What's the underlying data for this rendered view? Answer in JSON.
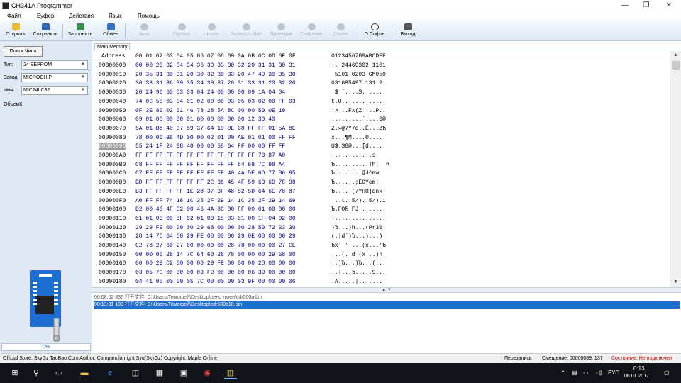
{
  "window": {
    "title": "CH341A Programmer",
    "minimize": "—",
    "restore": "❐",
    "close": "✕"
  },
  "menu": [
    "Файл",
    "Буфер",
    "Действия",
    "Язык",
    "Помощь"
  ],
  "toolbar": [
    {
      "label": "Открыть",
      "icon": "folder-open-icon",
      "enabled": true
    },
    {
      "label": "Сохранить",
      "icon": "save-icon",
      "enabled": true
    },
    {
      "label": "Заполнить",
      "icon": "fill-icon",
      "enabled": true
    },
    {
      "label": "Обмен",
      "icon": "swap-icon",
      "enabled": true
    },
    {
      "label": "Авто",
      "icon": "auto-icon",
      "enabled": false
    },
    {
      "label": "Пустые",
      "icon": "blank-check-icon",
      "enabled": false
    },
    {
      "label": "Читать",
      "icon": "read-icon",
      "enabled": false
    },
    {
      "label": "Записать Чип",
      "icon": "write-chip-icon",
      "enabled": false
    },
    {
      "label": "Проверка",
      "icon": "verify-icon",
      "enabled": false
    },
    {
      "label": "Стирание",
      "icon": "erase-icon",
      "enabled": false
    },
    {
      "label": "Отмен",
      "icon": "cancel-icon",
      "enabled": false
    },
    {
      "label": "О Софте",
      "icon": "info-icon",
      "enabled": true
    },
    {
      "label": "Выход",
      "icon": "exit-icon",
      "enabled": true
    }
  ],
  "left": {
    "find_chip": "Поиск Чипа",
    "type_label": "Тип:",
    "type_value": "24 EEPROM",
    "vendor_label": "Завод",
    "vendor_value": "MICROCHIP",
    "name_label": "Имя:",
    "name_value": "MIC24LC32",
    "size_label": "ОбъемК",
    "progress": "0%"
  },
  "tab": "Main Memory",
  "hex": {
    "header_addr": "Address",
    "header_cols": "00 01 02 03 04 05 06 07 08 09 0A 0B 0C 0D 0E 0F",
    "header_text": "0123456789ABCDEF",
    "current_row": 9,
    "rows": [
      {
        "addr": "00000000",
        "bytes": "00 00 20 32 34 34 36 39 33 30 32 20 31 31 30 31",
        "text": ".. 24469302 1101"
      },
      {
        "addr": "00000010",
        "bytes": "20 35 31 30 31 20 30 32 30 33 20 47 4D 30 35 30",
        "text": " 5101 0203 GM050"
      },
      {
        "addr": "00000020",
        "bytes": "30 33 31 36 39 35 34 39 37 20 31 33 31 20 32 20",
        "text": "031695497 131 2 "
      },
      {
        "addr": "00000030",
        "bytes": "20 24 96 60 03 03 04 24 00 00 00 09 1A 04 04",
        "text": " $ `....$......."
      },
      {
        "addr": "00000040",
        "bytes": "74 0C 55 03 04 01 02 00 00 03 05 03 02 00 FF 03",
        "text": "t.U............."
      },
      {
        "addr": "00000050",
        "bytes": "0F 3E 80 02 01 46 78 28 5A 8C 00 00 50 0E 10",
        "text": ".> ..Fx(Z ...P.."
      },
      {
        "addr": "00000060",
        "bytes": "09 01 00 00 00 01 60 00 00 00 00 12 30 40",
        "text": ".........`....0@"
      },
      {
        "addr": "00000070",
        "bytes": "5A 01 B8 40 37 59 37 64 19 0E C8 FF FF 01 5A 8E",
        "text": "Z.»@7Y7d..Ё...ZЋ"
      },
      {
        "addr": "00000080",
        "bytes": "78 00 00 B6 4D 00 00 02 01 00 AE 01 01 00 FF FF",
        "text": "x...¶M....®....."
      },
      {
        "addr": "00000090",
        "bytes": "55 24 1F 24 38 40 00 00 58 64 FF 00 00 FF FF",
        "text": "U$.$8@...[d....."
      },
      {
        "addr": "000000A0",
        "bytes": "FF FF FF FF FF FF FF FF FF FF FF FF 73 87 A0",
        "text": "............s"
      },
      {
        "addr": "000000B0",
        "bytes": "C8 FF FF FF FF FF FF FF FF FF 54 68 7C 98 A4",
        "text": "Ђ..........Th|  ¤"
      },
      {
        "addr": "000000C0",
        "bytes": "C7 FF FF FF FF FF FF FF FF 40 4A 5E 6D 77 86 95",
        "text": "Ђ........@J^mw"
      },
      {
        "addr": "000000D0",
        "bytes": "BD FF FF FF FF FF FF 2C 38 45 4F 59 63 6D 7C 98",
        "text": "Ђ......;EOYcm|"
      },
      {
        "addr": "000000E0",
        "bytes": "B3 FF FF FF FF 1E 28 37 3F 48 52 5D 64 6E 78 87",
        "text": "Ђ.....(7?HR]dnx"
      },
      {
        "addr": "000000F0",
        "bytes": "A0 FF FF 74 18 1C 35 2F 29 14 1C 35 2F 29 14 69",
        "text": " ..t..5/)..5/).i"
      },
      {
        "addr": "00000100",
        "bytes": "D2 00 46 4F C2 00 46 4A 8C 00 FF 00 01 00 00 00",
        "text": "Ђ.FOЂ.FJ ......."
      },
      {
        "addr": "00000110",
        "bytes": "01 01 00 00 0F 02 01 00 15 03 01 00 1F 04 02 00",
        "text": "................"
      },
      {
        "addr": "00000120",
        "bytes": "29 29 FE 00 00 00 29 68 00 00 00 28 50 72 33 30",
        "text": ")Ђ...)h...(Pr30"
      },
      {
        "addr": "00000130",
        "bytes": "28 14 7C 64 60 29 FE 00 00 00 29 0E 00 00 00 29",
        "text": "(.|d`)Ђ...)...)"
      },
      {
        "addr": "00000140",
        "bytes": "C2 78 27 60 27 60 00 00 00 28 78 00 00 00 27 CE",
        "text": "Ђx'`'`...(x...'Ђ"
      },
      {
        "addr": "00000150",
        "bytes": "00 00 00 28 14 7C 64 60 28 78 00 00 00 29 68 00",
        "text": "...(.|d`(x...)h."
      },
      {
        "addr": "00000160",
        "bytes": "00 00 29 C2 00 00 00 29 FE 00 00 00 28 00 00 00",
        "text": "..)Ђ...)Ђ...(..."
      },
      {
        "addr": "00000170",
        "bytes": "03 05 7C 00 00 00 03 F9 00 00 00 06 39 00 00 00",
        "text": "..|...Ђ.....9..."
      },
      {
        "addr": "00000180",
        "bytes": "04 41 00 00 00 05 7C 00 00 00 03 9F 00 00 00 06",
        "text": ".A.....|......."
      }
    ]
  },
  "log": [
    {
      "text": "00:08:02 837 打开文件: C:\\Users\\Тимофей\\Desktop\\рено лыен\\cdr500a.bin",
      "selected": false
    },
    {
      "text": "00:13:31 109 打开文件: C:\\Users\\Тимофей\\Desktop\\cdr500a10.bin",
      "selected": true
    }
  ],
  "status": {
    "left": "Official Store: SkyGz TaoBao.Com Author: Campanula night Syu(SkyGz) Copyright: Maple Online",
    "mode": "Перезапись",
    "offset": "Смещение: 00000089, 137",
    "state": "Состояние: Не подключен",
    "state_color": "#c00000"
  },
  "taskbar": {
    "lang": "РУС",
    "time": "0:13",
    "date": "06.01.2017"
  }
}
